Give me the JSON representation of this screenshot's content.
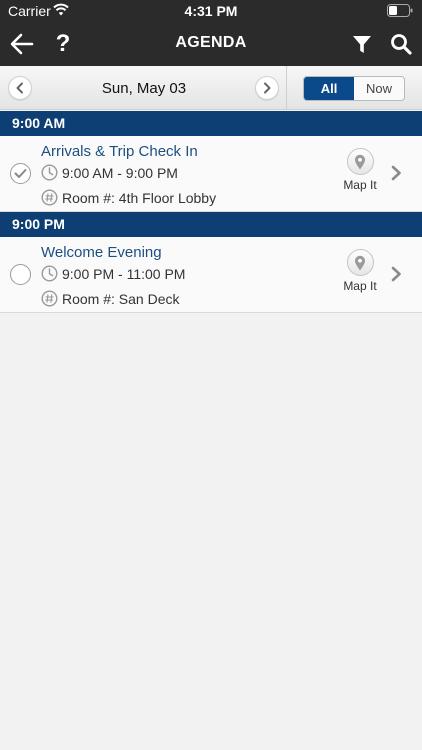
{
  "status_bar": {
    "carrier": "Carrier",
    "time": "4:31 PM"
  },
  "nav": {
    "title": "AGENDA",
    "help_label": "?",
    "icons": [
      "arrow-left-icon",
      "question-mark-icon",
      "filter-icon",
      "search-icon"
    ]
  },
  "date_bar": {
    "date": "Sun, May 03",
    "segments": [
      {
        "label": "All",
        "selected": true
      },
      {
        "label": "Now",
        "selected": false
      }
    ]
  },
  "colors": {
    "bar_dark": "#2b2b2b",
    "time_header": "#0d3f74",
    "segment_active": "#0a4a8a",
    "event_title": "#1d4f80"
  },
  "agenda": [
    {
      "time_header": "9:00 AM",
      "event": {
        "title": "Arrivals & Trip Check In",
        "time_range": "9:00 AM - 9:00 PM",
        "room": "Room #: 4th Floor Lobby",
        "checked": true,
        "map_label": "Map It"
      }
    },
    {
      "time_header": "9:00 PM",
      "event": {
        "title": "Welcome Evening",
        "time_range": "9:00 PM - 11:00 PM",
        "room": "Room #: San Deck",
        "checked": false,
        "map_label": "Map It"
      }
    }
  ]
}
